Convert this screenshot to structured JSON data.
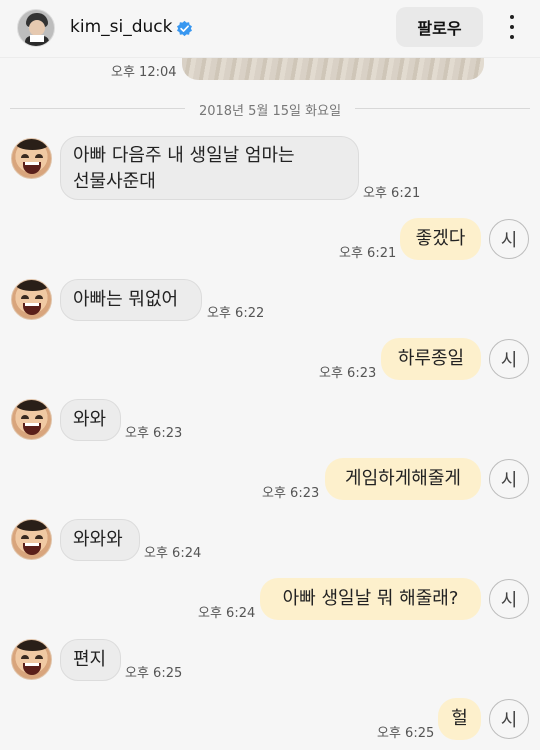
{
  "header": {
    "username": "kim_si_duck",
    "follow_label": "팔로우",
    "verified_icon": "verified-badge-icon",
    "accent_color": "#3897f0"
  },
  "top_message": {
    "time": "오후 12:04"
  },
  "date_separator": "2018년 5월 15일 화요일",
  "messages": [
    {
      "side": "in",
      "lines": [
        "아빠 다음주 내 생일날 엄마는",
        "선물사준대"
      ],
      "time": "오후 6:21"
    },
    {
      "side": "out",
      "text": "좋겠다",
      "time": "오후 6:21",
      "read_label": "시"
    },
    {
      "side": "in",
      "text": "아빠는 뭐없어",
      "time": "오후 6:22"
    },
    {
      "side": "out",
      "text": "하루종일",
      "time": "오후 6:23",
      "read_label": "시"
    },
    {
      "side": "in",
      "text": "와와",
      "time": "오후 6:23"
    },
    {
      "side": "out",
      "text": "게임하게해줄게",
      "time": "오후 6:23",
      "read_label": "시"
    },
    {
      "side": "in",
      "text": "와와와",
      "time": "오후 6:24"
    },
    {
      "side": "out",
      "text": "아빠 생일날 뭐 해줄래?",
      "time": "오후 6:24",
      "read_label": "시"
    },
    {
      "side": "in",
      "text": "편지",
      "time": "오후 6:25"
    },
    {
      "side": "out",
      "text": "헐",
      "time": "오후 6:25",
      "read_label": "시"
    }
  ]
}
